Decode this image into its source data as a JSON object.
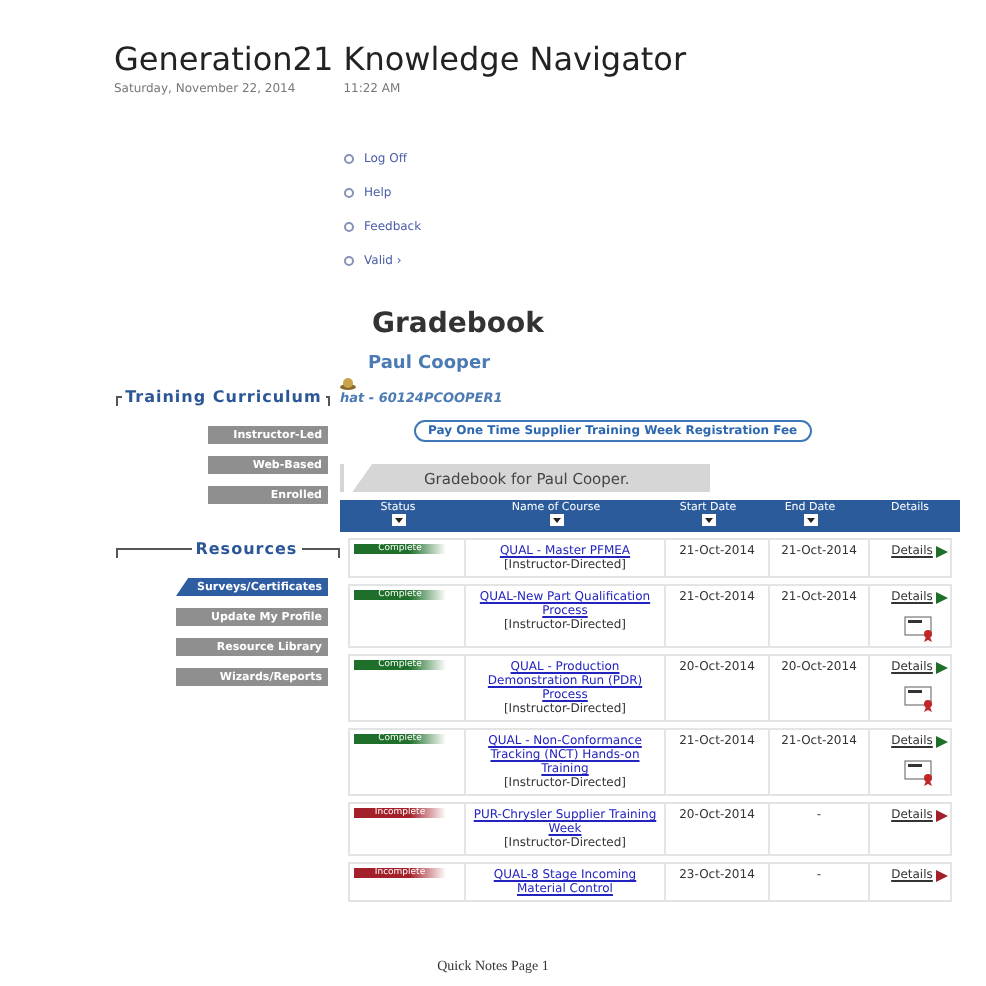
{
  "page": {
    "title": "Generation21 Knowledge Navigator",
    "date": "Saturday, November 22, 2014",
    "time": "11:22 AM",
    "footer": "Quick Notes Page 1"
  },
  "top_links": [
    "Log Off",
    "Help",
    "Feedback",
    "Valid ›"
  ],
  "heading": "Gradebook",
  "user": {
    "name": "Paul Cooper",
    "id": "hat - 60124PCOOPER1"
  },
  "sidebar": [
    {
      "title": "Training Curriculum",
      "items": [
        {
          "label": "Instructor-Led",
          "selected": false
        },
        {
          "label": "Web-Based",
          "selected": false
        },
        {
          "label": "Enrolled",
          "selected": false
        }
      ]
    },
    {
      "title": "Resources",
      "items": [
        {
          "label": "Surveys/Certificates",
          "selected": true
        },
        {
          "label": "Update My Profile",
          "selected": false
        },
        {
          "label": "Resource Library",
          "selected": false
        },
        {
          "label": "Wizards/Reports",
          "selected": false
        }
      ]
    }
  ],
  "pay_button": "Pay One Time Supplier Training Week Registration Fee",
  "gradebook_title": "Gradebook for Paul Cooper.",
  "table": {
    "columns": [
      "Status",
      "Name of Course",
      "Start Date",
      "End Date",
      "Details"
    ],
    "rows": [
      {
        "status": "Complete",
        "kind": "complete",
        "course": "QUAL - Master PFMEA",
        "type": "[Instructor-Directed]",
        "start": "21-Oct-2014",
        "end": "21-Oct-2014",
        "details": "Details",
        "certificate": false
      },
      {
        "status": "Complete",
        "kind": "complete",
        "course": "QUAL-New Part Qualification Process",
        "type": "[Instructor-Directed]",
        "start": "21-Oct-2014",
        "end": "21-Oct-2014",
        "details": "Details",
        "certificate": true
      },
      {
        "status": "Complete",
        "kind": "complete",
        "course": "QUAL - Production Demonstration Run (PDR) Process",
        "type": "[Instructor-Directed]",
        "start": "20-Oct-2014",
        "end": "20-Oct-2014",
        "details": "Details",
        "certificate": true
      },
      {
        "status": "Complete",
        "kind": "complete",
        "course": "QUAL - Non-Conformance Tracking (NCT) Hands-on Training",
        "type": "[Instructor-Directed]",
        "start": "21-Oct-2014",
        "end": "21-Oct-2014",
        "details": "Details",
        "certificate": true
      },
      {
        "status": "Incomplete",
        "kind": "incomplete",
        "course": "PUR-Chrysler Supplier Training Week",
        "type": "[Instructor-Directed]",
        "start": "20-Oct-2014",
        "end": "-",
        "details": "Details",
        "certificate": false
      },
      {
        "status": "Incomplete",
        "kind": "incomplete",
        "course": "QUAL-8 Stage Incoming Material Control",
        "start": "23-Oct-2014",
        "end": "-",
        "details": "Details",
        "certificate": false
      }
    ]
  }
}
